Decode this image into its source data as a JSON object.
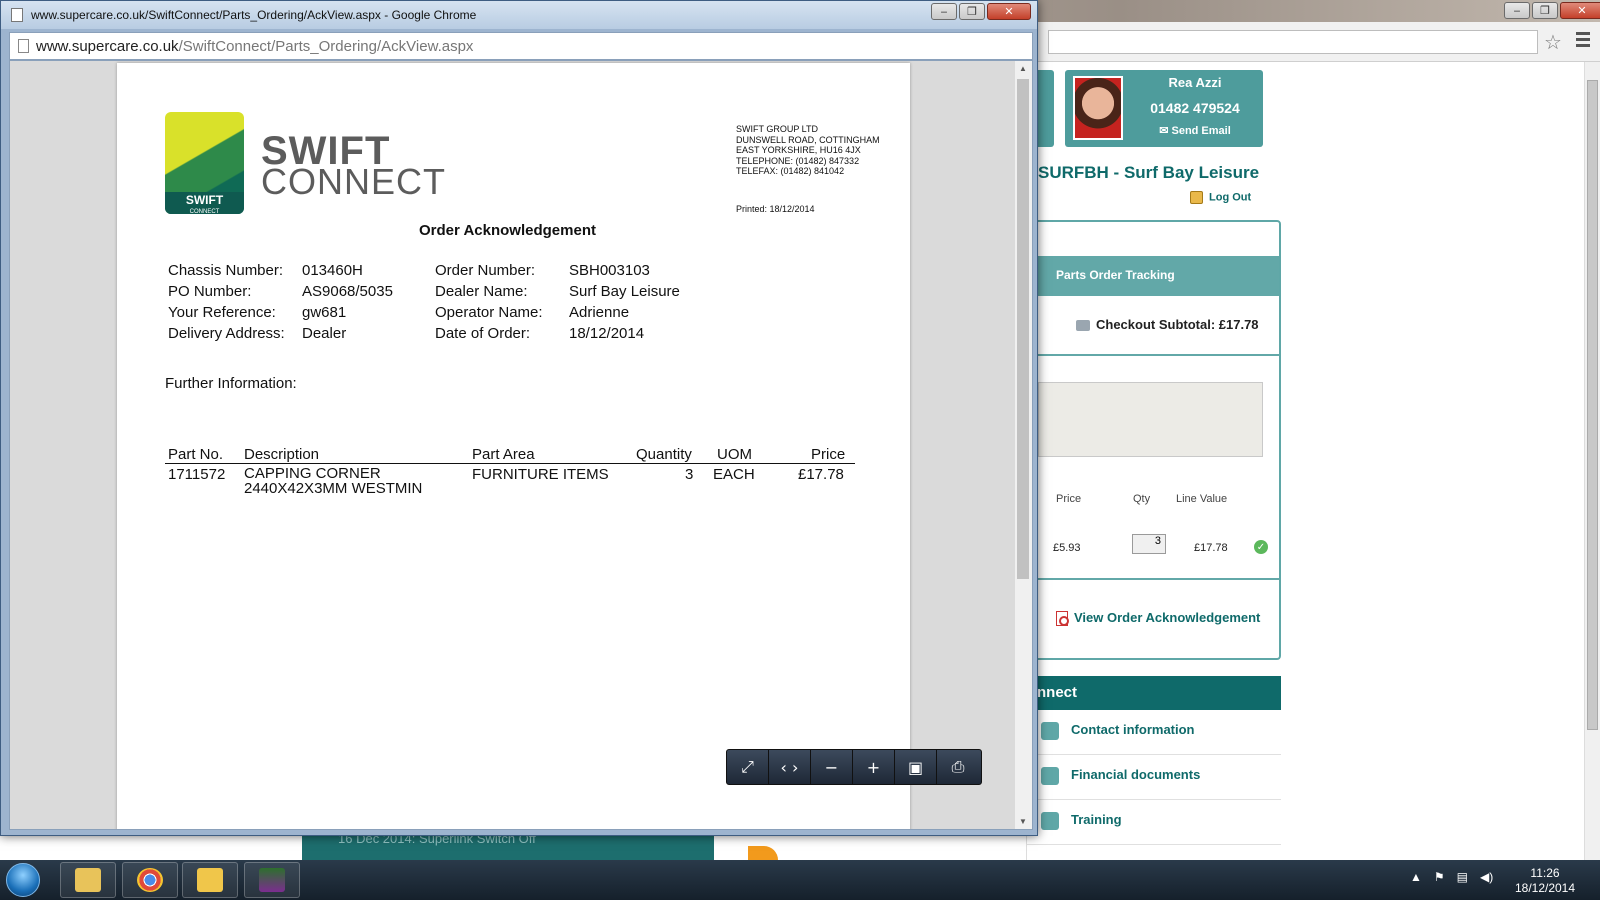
{
  "background_browser": {
    "profile": {
      "name": "Rea Azzi",
      "phone": "01482 479524",
      "email_label": "Send Email"
    },
    "dealer_title": "SURFBH - Surf Bay Leisure",
    "logout_label": "Log Out",
    "tracking": {
      "header": "Parts Order Tracking",
      "subtotal": "Checkout Subtotal: £17.78",
      "columns": {
        "price": "Price",
        "qty": "Qty",
        "line_value": "Line Value"
      },
      "row": {
        "price": "£5.93",
        "qty": "3",
        "line_value": "£17.78"
      },
      "view_ack_label": "View Order Acknowledgement"
    },
    "connect": {
      "header": "nnect",
      "items": [
        "Contact information",
        "Financial documents",
        "Training"
      ]
    },
    "news_item": "16 Dec 2014: Superlink Switch Off"
  },
  "popup": {
    "title": "www.supercare.co.uk/SwiftConnect/Parts_Ordering/AckView.aspx - Google Chrome",
    "url_domain": "www.supercare.co.uk",
    "url_path": "/SwiftConnect/Parts_Ordering/AckView.aspx"
  },
  "document": {
    "logo": {
      "badge": "SWIFT",
      "badge_sub": "CONNECT",
      "word1": "SWIFT",
      "word2": "CONNECT"
    },
    "company_address": [
      "SWIFT GROUP LTD",
      "DUNSWELL ROAD, COTTINGHAM",
      "EAST YORKSHIRE, HU16 4JX",
      "TELEPHONE: (01482) 847332",
      "TELEFAX: (01482) 841042"
    ],
    "printed": "Printed: 18/12/2014",
    "title": "Order Acknowledgement",
    "fields": {
      "chassis_label": "Chassis Number:",
      "chassis_value": "013460H",
      "po_label": "PO Number:",
      "po_value": "AS9068/5035",
      "ref_label": "Your Reference:",
      "ref_value": "gw681",
      "delivery_label": "Delivery Address:",
      "delivery_value": "Dealer",
      "order_label": "Order Number:",
      "order_value": "SBH003103",
      "dealer_label": "Dealer Name:",
      "dealer_value": "Surf Bay Leisure",
      "operator_label": "Operator Name:",
      "operator_value": "Adrienne",
      "date_label": "Date of Order:",
      "date_value": "18/12/2014"
    },
    "further_info_label": "Further Information:",
    "table": {
      "headers": {
        "part_no": "Part No.",
        "description": "Description",
        "part_area": "Part Area",
        "quantity": "Quantity",
        "uom": "UOM",
        "price": "Price"
      },
      "row": {
        "part_no": "1711572",
        "description_line1": "CAPPING CORNER",
        "description_line2": "2440X42X3MM WESTMIN",
        "part_area": "FURNITURE ITEMS",
        "quantity": "3",
        "uom": "EACH",
        "price": "£17.78"
      }
    }
  },
  "taskbar": {
    "time": "11:26",
    "date": "18/12/2014"
  }
}
